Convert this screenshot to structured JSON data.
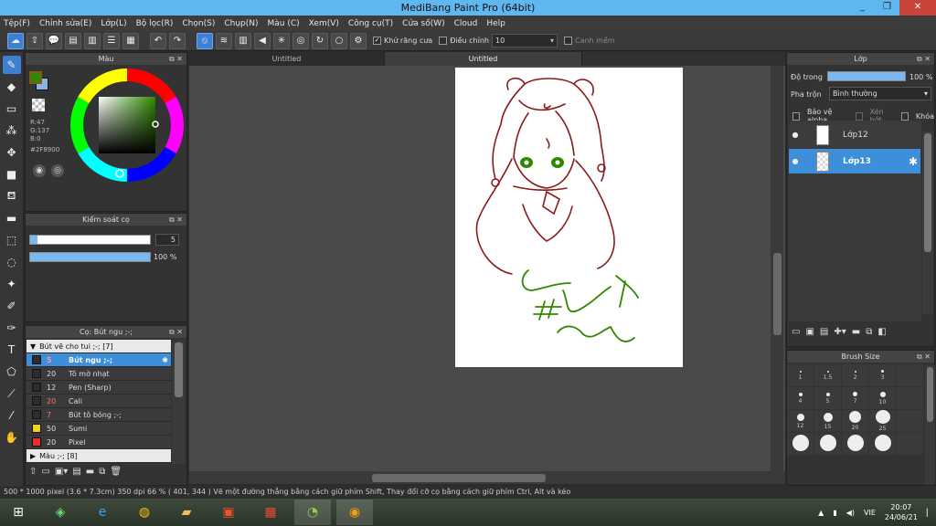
{
  "window": {
    "title": "MediBang Paint Pro (64bit)",
    "buttons": [
      "_",
      "❐",
      "✕"
    ]
  },
  "menu": [
    "Tệp(F)",
    "Chỉnh sửa(E)",
    "Lớp(L)",
    "Bộ lọc(R)",
    "Chọn(S)",
    "Chụp(N)",
    "Màu (C)",
    "Xem(V)",
    "Công cụ(T)",
    "Cửa số(W)",
    "Cloud",
    "Help"
  ],
  "toolbar": {
    "antialias_label": "Khử răng cưa",
    "adjust_label": "Điều chỉnh",
    "adjust_value": "10",
    "margin_label": "Canh mềm"
  },
  "tabs": [
    "Untitled",
    "Untitled"
  ],
  "color_panel": {
    "title": "Màu",
    "r": "R:47",
    "g": "G:137",
    "b": "B:0",
    "hex": "#2F8900",
    "primary": "#2f8900",
    "secondary": "#8fb3e0"
  },
  "brush_control": {
    "title": "Kiểm soát cọ",
    "size": "5",
    "opacity": "100 %"
  },
  "brush_list": {
    "title": "Cọ: Bút ngu ;-;",
    "group1": "Bút vẽ cho tui ;-; [7]",
    "group2": "Màu ;-; [8]",
    "items": [
      {
        "size": "5",
        "name": "Bút ngu ;-;",
        "color": "#2d2d2d",
        "selected": true
      },
      {
        "size": "20",
        "name": "Tô mờ nhạt",
        "color": "#2d2d2d",
        "selected": false
      },
      {
        "size": "12",
        "name": "Pen (Sharp)",
        "color": "#2d2d2d",
        "selected": false
      },
      {
        "size": "20",
        "name": "Cali",
        "color": "#2d2d2d",
        "selected": false,
        "red": true
      },
      {
        "size": "7",
        "name": "Bút tô bóng ;-;",
        "color": "#2d2d2d",
        "selected": false,
        "red": true
      },
      {
        "size": "50",
        "name": "Sumi",
        "color": "#f2d21b",
        "selected": false
      },
      {
        "size": "20",
        "name": "Pixel",
        "color": "#e53030",
        "selected": false
      }
    ]
  },
  "layer_panel": {
    "title": "Lớp",
    "opacity_label": "Độ trong",
    "opacity_value": "100 %",
    "blend_label": "Pha trộn",
    "blend_value": "Bình thường",
    "protect_alpha": "Bảo vệ alpha",
    "clip": "Xén bớt",
    "lock": "Khóa",
    "layers": [
      {
        "name": "Lớp12",
        "selected": false
      },
      {
        "name": "Lớp13",
        "selected": true
      }
    ]
  },
  "brush_size": {
    "title": "Brush Size",
    "cells": [
      "1",
      "1.5",
      "2",
      "3",
      "",
      "4",
      "5",
      "7",
      "10",
      "",
      "12",
      "15",
      "20",
      "25",
      "",
      "",
      "",
      "",
      "",
      ""
    ]
  },
  "status": {
    "text": "500 * 1000 pixel   (3.6 * 7.3cm)   350 dpi   66 %   ( 401, 344 )   Vẽ một đường thẳng bằng cách giữ phím Shift, Thay đổi cỡ cọ bằng cách giữ phím Ctrl, Alt và kéo"
  },
  "taskbar": {
    "lang": "VIE",
    "time": "20:07",
    "date": "24/06/21"
  }
}
